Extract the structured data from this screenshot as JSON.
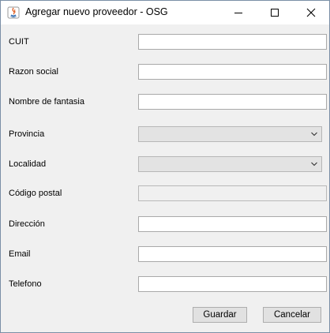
{
  "window": {
    "title": "Agregar nuevo proveedor - OSG",
    "app_icon": "java-icon"
  },
  "form": {
    "cuit": {
      "label": "CUIT",
      "value": ""
    },
    "razon_social": {
      "label": "Razon social",
      "value": ""
    },
    "nombre_fantasia": {
      "label": "Nombre de fantasia",
      "value": ""
    },
    "provincia": {
      "label": "Provincia",
      "selected": ""
    },
    "localidad": {
      "label": "Localidad",
      "selected": ""
    },
    "codigo_postal": {
      "label": "Código postal",
      "value": ""
    },
    "direccion": {
      "label": "Dirección",
      "value": ""
    },
    "email": {
      "label": "Email",
      "value": ""
    },
    "telefono": {
      "label": "Telefono",
      "value": ""
    }
  },
  "buttons": {
    "save": "Guardar",
    "cancel": "Cancelar"
  }
}
